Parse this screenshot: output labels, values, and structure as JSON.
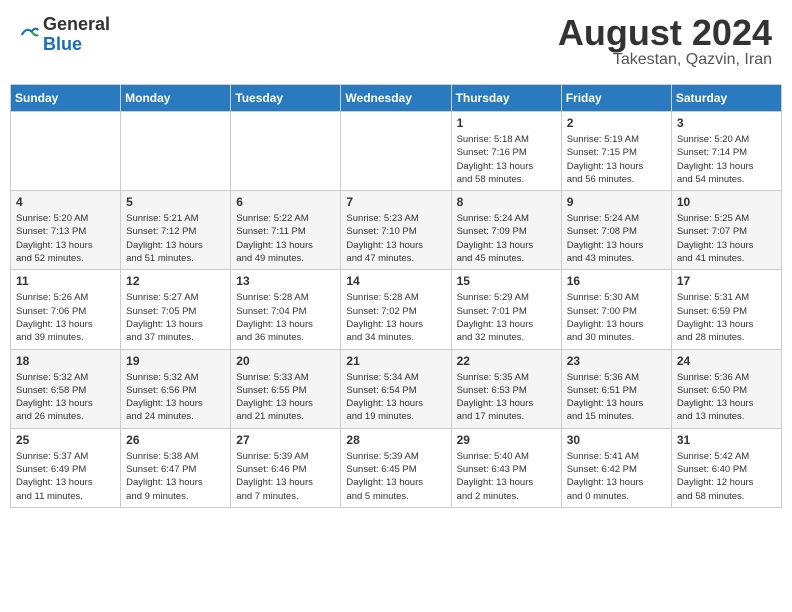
{
  "logo": {
    "general": "General",
    "blue": "Blue"
  },
  "title": {
    "month_year": "August 2024",
    "location": "Takestan, Qazvin, Iran"
  },
  "days_of_week": [
    "Sunday",
    "Monday",
    "Tuesday",
    "Wednesday",
    "Thursday",
    "Friday",
    "Saturday"
  ],
  "weeks": [
    [
      {
        "day": "",
        "info": ""
      },
      {
        "day": "",
        "info": ""
      },
      {
        "day": "",
        "info": ""
      },
      {
        "day": "",
        "info": ""
      },
      {
        "day": "1",
        "info": "Sunrise: 5:18 AM\nSunset: 7:16 PM\nDaylight: 13 hours\nand 58 minutes."
      },
      {
        "day": "2",
        "info": "Sunrise: 5:19 AM\nSunset: 7:15 PM\nDaylight: 13 hours\nand 56 minutes."
      },
      {
        "day": "3",
        "info": "Sunrise: 5:20 AM\nSunset: 7:14 PM\nDaylight: 13 hours\nand 54 minutes."
      }
    ],
    [
      {
        "day": "4",
        "info": "Sunrise: 5:20 AM\nSunset: 7:13 PM\nDaylight: 13 hours\nand 52 minutes."
      },
      {
        "day": "5",
        "info": "Sunrise: 5:21 AM\nSunset: 7:12 PM\nDaylight: 13 hours\nand 51 minutes."
      },
      {
        "day": "6",
        "info": "Sunrise: 5:22 AM\nSunset: 7:11 PM\nDaylight: 13 hours\nand 49 minutes."
      },
      {
        "day": "7",
        "info": "Sunrise: 5:23 AM\nSunset: 7:10 PM\nDaylight: 13 hours\nand 47 minutes."
      },
      {
        "day": "8",
        "info": "Sunrise: 5:24 AM\nSunset: 7:09 PM\nDaylight: 13 hours\nand 45 minutes."
      },
      {
        "day": "9",
        "info": "Sunrise: 5:24 AM\nSunset: 7:08 PM\nDaylight: 13 hours\nand 43 minutes."
      },
      {
        "day": "10",
        "info": "Sunrise: 5:25 AM\nSunset: 7:07 PM\nDaylight: 13 hours\nand 41 minutes."
      }
    ],
    [
      {
        "day": "11",
        "info": "Sunrise: 5:26 AM\nSunset: 7:06 PM\nDaylight: 13 hours\nand 39 minutes."
      },
      {
        "day": "12",
        "info": "Sunrise: 5:27 AM\nSunset: 7:05 PM\nDaylight: 13 hours\nand 37 minutes."
      },
      {
        "day": "13",
        "info": "Sunrise: 5:28 AM\nSunset: 7:04 PM\nDaylight: 13 hours\nand 36 minutes."
      },
      {
        "day": "14",
        "info": "Sunrise: 5:28 AM\nSunset: 7:02 PM\nDaylight: 13 hours\nand 34 minutes."
      },
      {
        "day": "15",
        "info": "Sunrise: 5:29 AM\nSunset: 7:01 PM\nDaylight: 13 hours\nand 32 minutes."
      },
      {
        "day": "16",
        "info": "Sunrise: 5:30 AM\nSunset: 7:00 PM\nDaylight: 13 hours\nand 30 minutes."
      },
      {
        "day": "17",
        "info": "Sunrise: 5:31 AM\nSunset: 6:59 PM\nDaylight: 13 hours\nand 28 minutes."
      }
    ],
    [
      {
        "day": "18",
        "info": "Sunrise: 5:32 AM\nSunset: 6:58 PM\nDaylight: 13 hours\nand 26 minutes."
      },
      {
        "day": "19",
        "info": "Sunrise: 5:32 AM\nSunset: 6:56 PM\nDaylight: 13 hours\nand 24 minutes."
      },
      {
        "day": "20",
        "info": "Sunrise: 5:33 AM\nSunset: 6:55 PM\nDaylight: 13 hours\nand 21 minutes."
      },
      {
        "day": "21",
        "info": "Sunrise: 5:34 AM\nSunset: 6:54 PM\nDaylight: 13 hours\nand 19 minutes."
      },
      {
        "day": "22",
        "info": "Sunrise: 5:35 AM\nSunset: 6:53 PM\nDaylight: 13 hours\nand 17 minutes."
      },
      {
        "day": "23",
        "info": "Sunrise: 5:36 AM\nSunset: 6:51 PM\nDaylight: 13 hours\nand 15 minutes."
      },
      {
        "day": "24",
        "info": "Sunrise: 5:36 AM\nSunset: 6:50 PM\nDaylight: 13 hours\nand 13 minutes."
      }
    ],
    [
      {
        "day": "25",
        "info": "Sunrise: 5:37 AM\nSunset: 6:49 PM\nDaylight: 13 hours\nand 11 minutes."
      },
      {
        "day": "26",
        "info": "Sunrise: 5:38 AM\nSunset: 6:47 PM\nDaylight: 13 hours\nand 9 minutes."
      },
      {
        "day": "27",
        "info": "Sunrise: 5:39 AM\nSunset: 6:46 PM\nDaylight: 13 hours\nand 7 minutes."
      },
      {
        "day": "28",
        "info": "Sunrise: 5:39 AM\nSunset: 6:45 PM\nDaylight: 13 hours\nand 5 minutes."
      },
      {
        "day": "29",
        "info": "Sunrise: 5:40 AM\nSunset: 6:43 PM\nDaylight: 13 hours\nand 2 minutes."
      },
      {
        "day": "30",
        "info": "Sunrise: 5:41 AM\nSunset: 6:42 PM\nDaylight: 13 hours\nand 0 minutes."
      },
      {
        "day": "31",
        "info": "Sunrise: 5:42 AM\nSunset: 6:40 PM\nDaylight: 12 hours\nand 58 minutes."
      }
    ]
  ]
}
